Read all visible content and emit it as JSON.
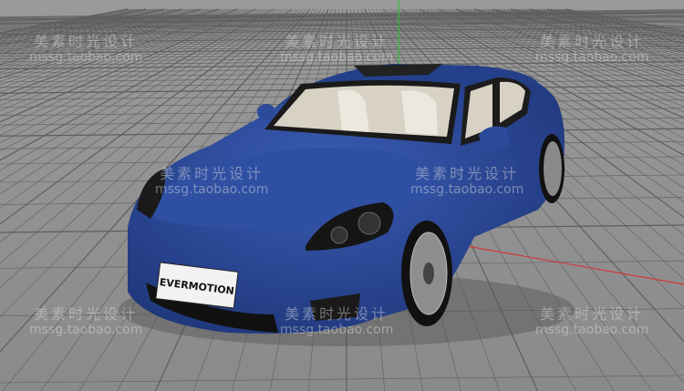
{
  "viewport": {
    "background_color": "#8c8c8c",
    "grid_color": "#5e5e5e",
    "y_axis_color": "#2fbf3a",
    "x_axis_color": "#d23a3a",
    "car_body_color": "#2c4a9a",
    "license_plate": "EVERMOTION"
  },
  "watermarks": [
    {
      "cn": "美素时光设计",
      "url": "mssg.taobao.com"
    },
    {
      "cn": "美素时光设计",
      "url": "mssg.taobao.com"
    },
    {
      "cn": "美素时光设计",
      "url": "mssg.taobao.com"
    },
    {
      "cn": "美素时光设计",
      "url": "mssg.taobao.com"
    },
    {
      "cn": "美素时光设计",
      "url": "mssg.taobao.com"
    },
    {
      "cn": "美素时光设计",
      "url": "mssg.taobao.com"
    },
    {
      "cn": "美素时光设计",
      "url": "mssg.taobao.com"
    },
    {
      "cn": "美素时光设计",
      "url": "mssg.taobao.com"
    }
  ]
}
